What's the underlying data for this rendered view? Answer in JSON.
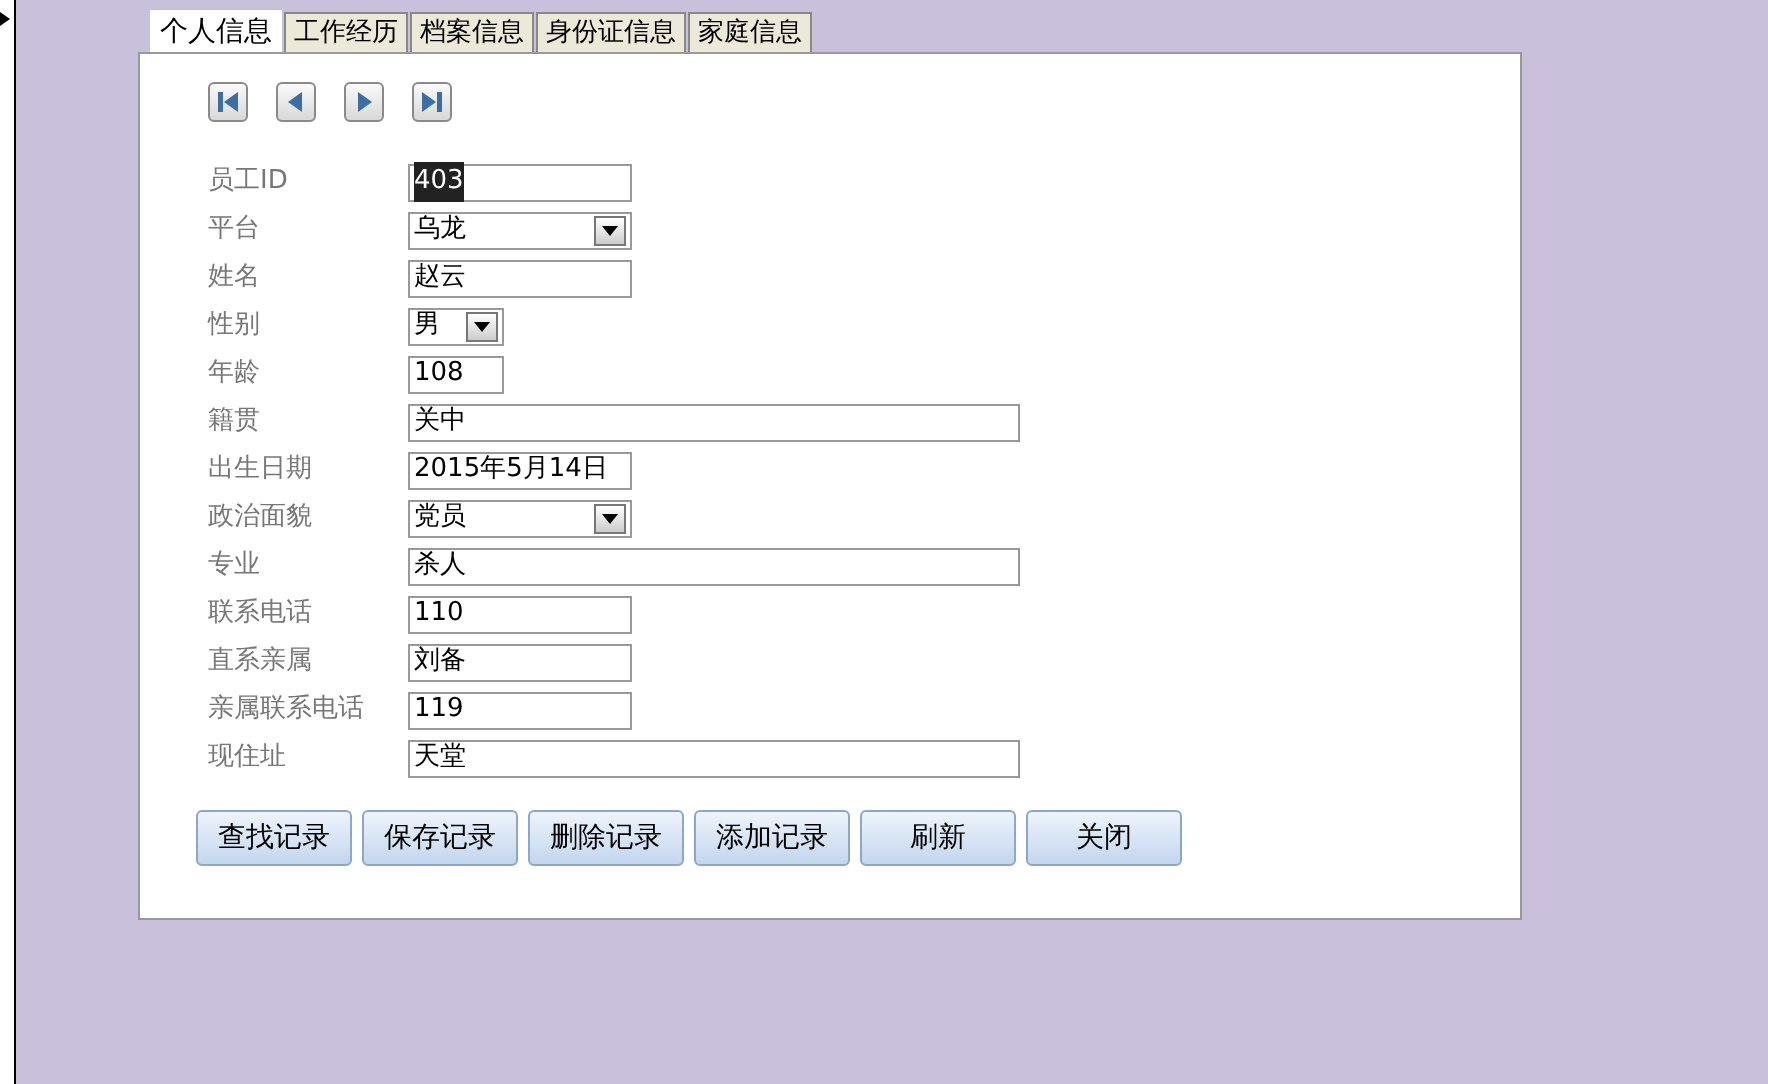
{
  "tabs": [
    {
      "label": "个人信息",
      "selected": true
    },
    {
      "label": "工作经历",
      "selected": false
    },
    {
      "label": "档案信息",
      "selected": false
    },
    {
      "label": "身份证信息",
      "selected": false
    },
    {
      "label": "家庭信息",
      "selected": false
    }
  ],
  "navigation": [
    {
      "kind": "first"
    },
    {
      "kind": "previous"
    },
    {
      "kind": "next"
    },
    {
      "kind": "last"
    }
  ],
  "fields": [
    {
      "label": "员工ID",
      "kind": "text",
      "value": "403",
      "highlighted": true
    },
    {
      "label": "平台",
      "kind": "combo",
      "value": "乌龙"
    },
    {
      "label": "姓名",
      "kind": "text",
      "value": "赵云",
      "highlighted": false
    },
    {
      "label": "性别",
      "kind": "combo",
      "value": "男"
    },
    {
      "label": "年龄",
      "kind": "text",
      "value": "108",
      "highlighted": false
    },
    {
      "label": "籍贯",
      "kind": "text",
      "value": "关中",
      "highlighted": false
    },
    {
      "label": "出生日期",
      "kind": "text",
      "value": "2015年5月14日",
      "highlighted": false
    },
    {
      "label": "政治面貌",
      "kind": "combo",
      "value": "党员"
    },
    {
      "label": "专业",
      "kind": "text",
      "value": "杀人",
      "highlighted": false
    },
    {
      "label": "联系电话",
      "kind": "text",
      "value": "110",
      "highlighted": false
    },
    {
      "label": "直系亲属",
      "kind": "text",
      "value": "刘备",
      "highlighted": false
    },
    {
      "label": "亲属联系电话",
      "kind": "text",
      "value": "119",
      "highlighted": false
    },
    {
      "label": "现住址",
      "kind": "text",
      "value": "天堂",
      "highlighted": false
    }
  ],
  "buttons": [
    "查找记录",
    "保存记录",
    "删除记录",
    "添加记录",
    "刷新",
    "关闭"
  ]
}
